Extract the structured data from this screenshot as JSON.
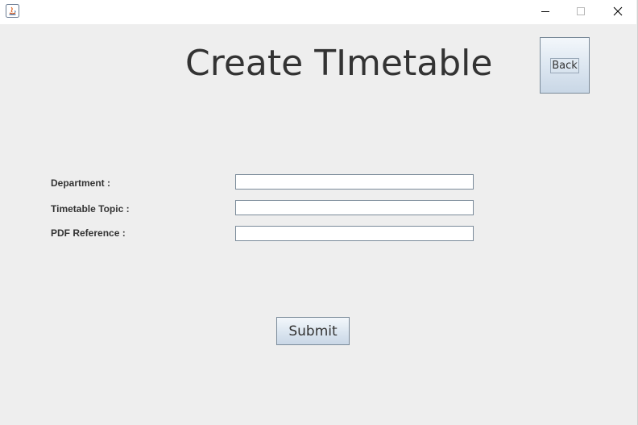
{
  "window": {
    "controls": {
      "minimize_icon": "minimize-icon",
      "maximize_icon": "maximize-icon",
      "close_icon": "close-icon"
    }
  },
  "page": {
    "title": "Create TImetable"
  },
  "buttons": {
    "back_label": "Back",
    "submit_label": "Submit"
  },
  "form": {
    "fields": [
      {
        "label": "Department :",
        "value": ""
      },
      {
        "label": "Timetable Topic :",
        "value": ""
      },
      {
        "label": "PDF Reference :",
        "value": ""
      }
    ]
  },
  "colors": {
    "background": "#eeeeee",
    "button_gradient_top": "#f3f7fb",
    "button_gradient_bottom": "#c9d7e6",
    "border": "#7a8a99",
    "text": "#333333"
  }
}
